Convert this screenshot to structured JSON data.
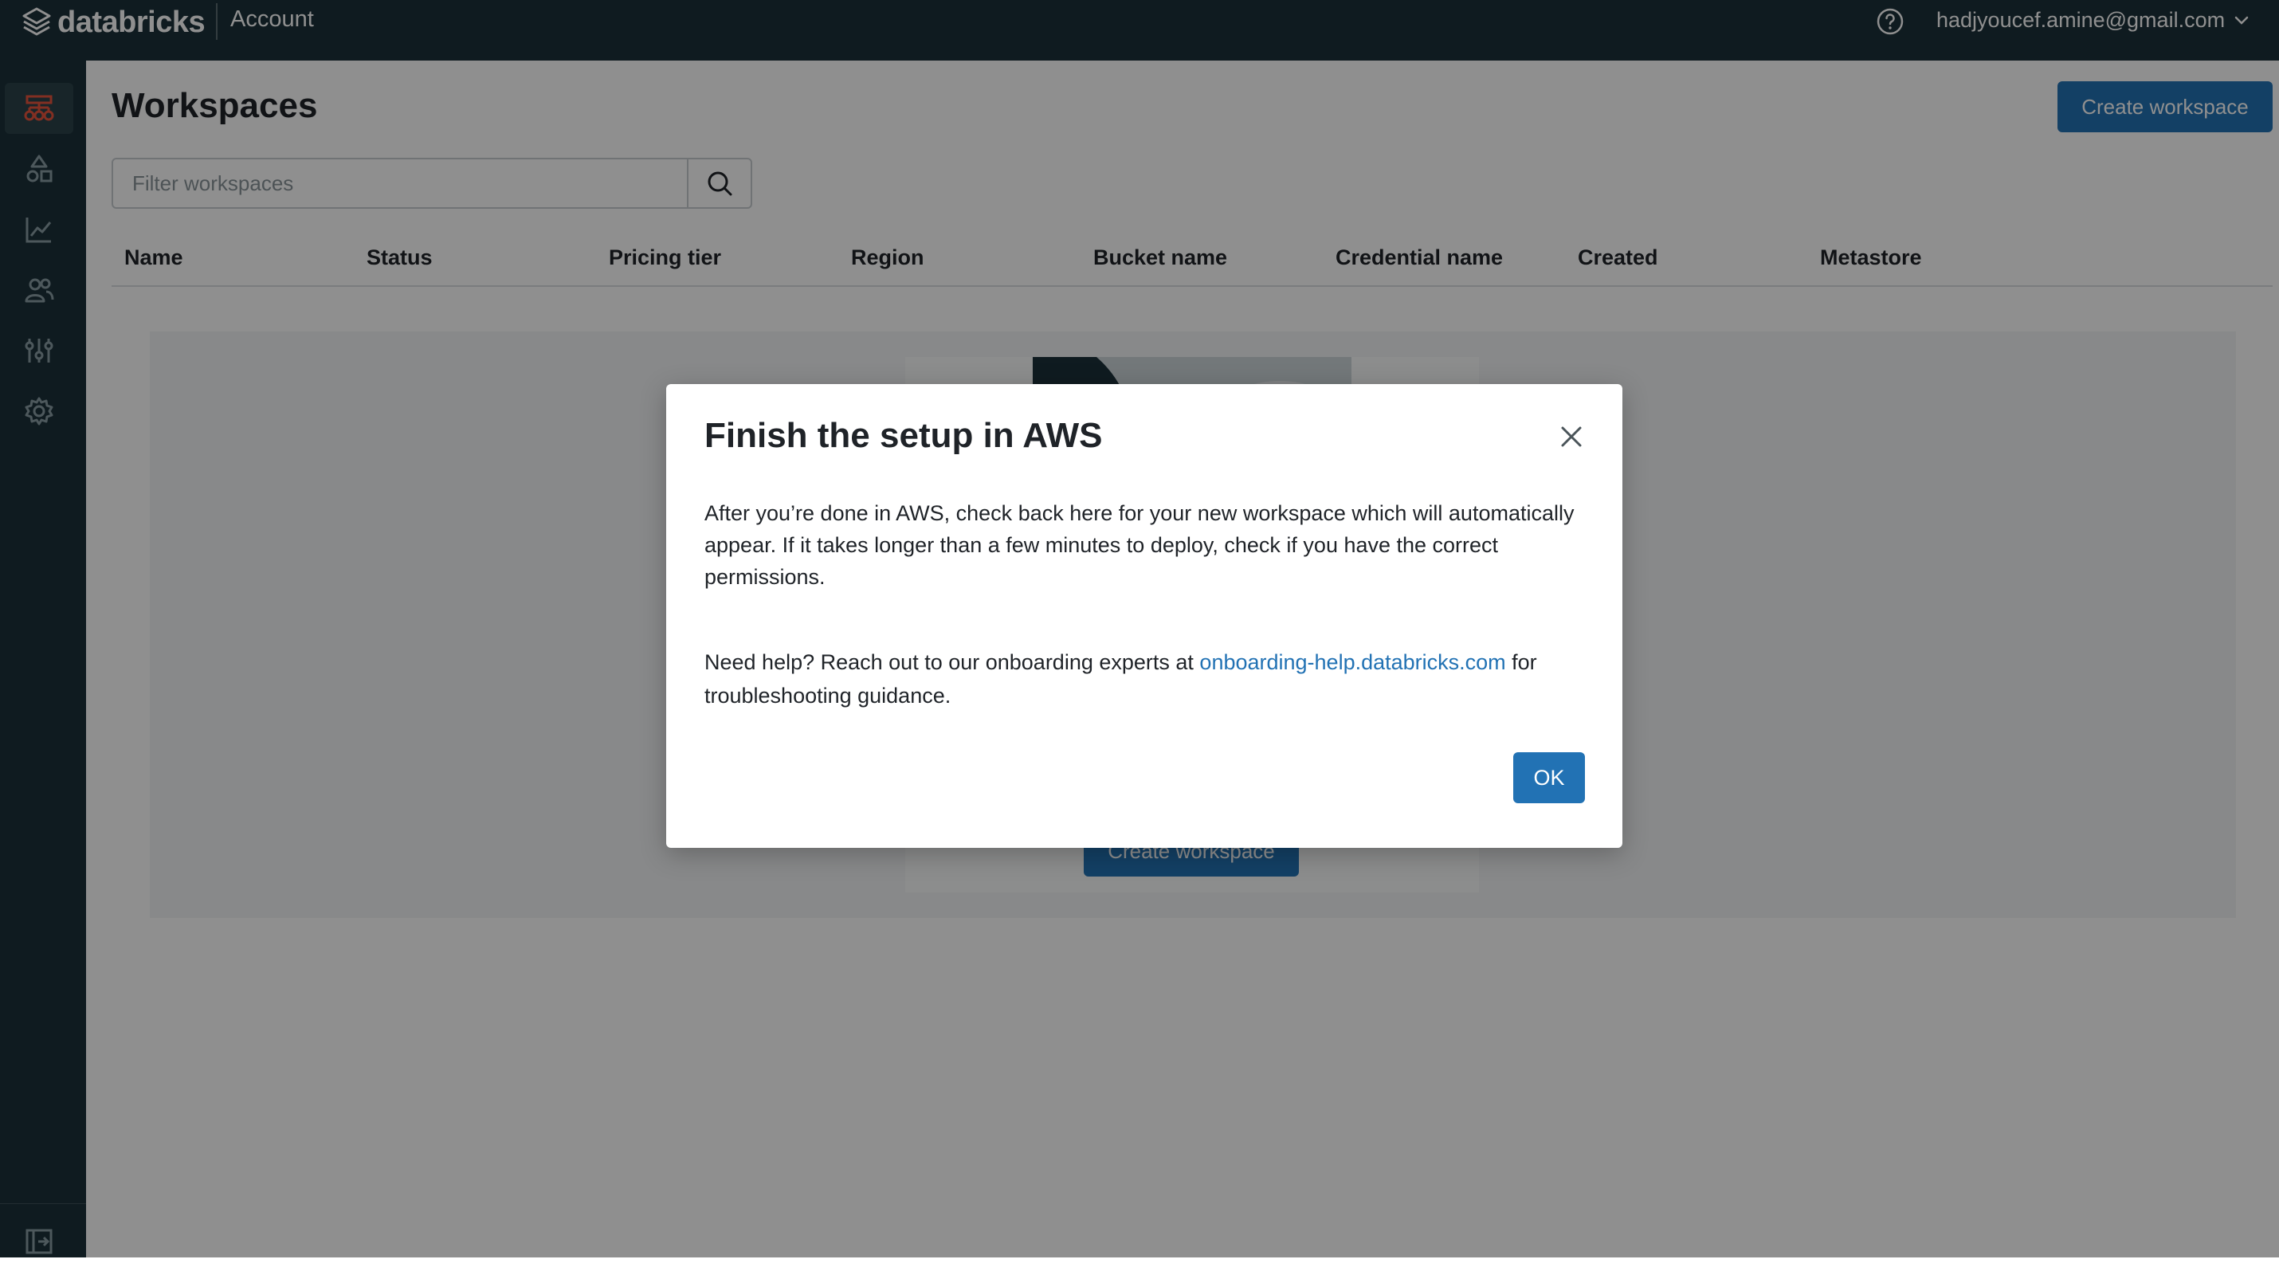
{
  "header": {
    "logo_text": "databricks",
    "section": "Account",
    "user_email": "hadjyoucef.amine@gmail.com"
  },
  "sidebar": {
    "items": [
      {
        "icon": "workspaces-icon",
        "active": true
      },
      {
        "icon": "catalog-icon",
        "active": false
      },
      {
        "icon": "usage-chart-icon",
        "active": false
      },
      {
        "icon": "user-management-icon",
        "active": false
      },
      {
        "icon": "cloud-resources-icon",
        "active": false
      },
      {
        "icon": "settings-gear-icon",
        "active": false
      }
    ],
    "collapse_icon": "collapse-sidebar-icon"
  },
  "page": {
    "title": "Workspaces",
    "create_button": "Create workspace",
    "filter_placeholder": "Filter workspaces"
  },
  "table": {
    "columns": [
      "Name",
      "Status",
      "Pricing tier",
      "Region",
      "Bucket name",
      "Credential name",
      "Created",
      "Metastore"
    ]
  },
  "empty_state": {
    "create_button": "Create workspace"
  },
  "modal": {
    "title": "Finish the setup in AWS",
    "paragraph1": "After you’re done in AWS, check back here for your new workspace which will automatically appear. If it takes longer than a few minutes to deploy, check if you have the correct permissions.",
    "paragraph2_before": "Need help? Reach out to our onboarding experts at ",
    "paragraph2_link": "onboarding-help.databricks.com",
    "paragraph2_after": " for troubleshooting guidance.",
    "ok_button": "OK"
  },
  "colors": {
    "nav_bg": "#1b3139",
    "primary": "#2272b4",
    "active_icon": "#e8543e"
  }
}
